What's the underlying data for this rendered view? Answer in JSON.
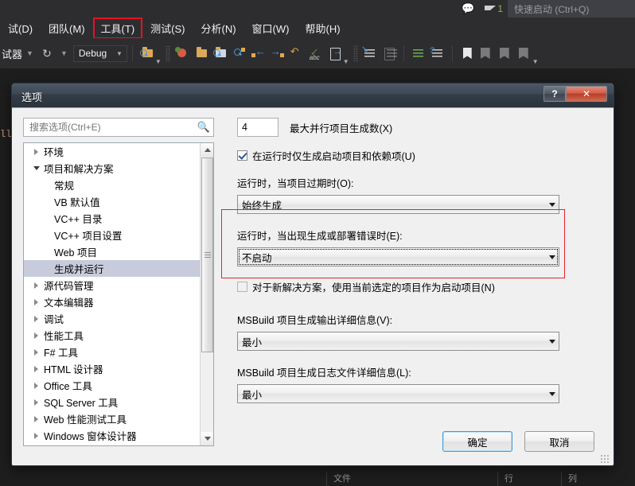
{
  "vs": {
    "title_icons": {
      "feedback": "feedback-icon",
      "notifications_count": "1"
    },
    "quick_launch_placeholder": "快速启动 (Ctrl+Q)",
    "menu": [
      {
        "label": "试(D)",
        "highlight": false
      },
      {
        "label": "团队(M)",
        "highlight": false
      },
      {
        "label": "工具(T)",
        "highlight": true
      },
      {
        "label": "测试(S)",
        "highlight": false
      },
      {
        "label": "分析(N)",
        "highlight": false
      },
      {
        "label": "窗口(W)",
        "highlight": false
      },
      {
        "label": "帮助(H)",
        "highlight": false
      }
    ],
    "toolbar": {
      "debugger_label": "试器",
      "config_value": "Debug"
    },
    "code_lines": [
      {
        "text": "ll;",
        "x": 0,
        "y": 76,
        "color": "#d69d85"
      }
    ],
    "statusbar": {
      "col1": "文件",
      "col2": "行",
      "col3": "列"
    },
    "accent_red": "#e8232a"
  },
  "dialog": {
    "title": "选项",
    "help_button": "?",
    "close_button": "✕",
    "search": {
      "placeholder": "搜索选项(Ctrl+E)",
      "value": ""
    },
    "tree": [
      {
        "label": "环境",
        "state": "collapsed",
        "level": 0,
        "selected": false
      },
      {
        "label": "项目和解决方案",
        "state": "expanded",
        "level": 0,
        "selected": false
      },
      {
        "label": "常规",
        "state": "leaf",
        "level": 1,
        "selected": false
      },
      {
        "label": "VB 默认值",
        "state": "leaf",
        "level": 1,
        "selected": false
      },
      {
        "label": "VC++ 目录",
        "state": "leaf",
        "level": 1,
        "selected": false
      },
      {
        "label": "VC++ 项目设置",
        "state": "leaf",
        "level": 1,
        "selected": false
      },
      {
        "label": "Web 项目",
        "state": "leaf",
        "level": 1,
        "selected": false
      },
      {
        "label": "生成并运行",
        "state": "leaf",
        "level": 1,
        "selected": true
      },
      {
        "label": "源代码管理",
        "state": "collapsed",
        "level": 0,
        "selected": false
      },
      {
        "label": "文本编辑器",
        "state": "collapsed",
        "level": 0,
        "selected": false
      },
      {
        "label": "调试",
        "state": "collapsed",
        "level": 0,
        "selected": false
      },
      {
        "label": "性能工具",
        "state": "collapsed",
        "level": 0,
        "selected": false
      },
      {
        "label": "F# 工具",
        "state": "collapsed",
        "level": 0,
        "selected": false
      },
      {
        "label": "HTML 设计器",
        "state": "collapsed",
        "level": 0,
        "selected": false
      },
      {
        "label": "Office 工具",
        "state": "collapsed",
        "level": 0,
        "selected": false
      },
      {
        "label": "SQL Server 工具",
        "state": "collapsed",
        "level": 0,
        "selected": false
      },
      {
        "label": "Web 性能测试工具",
        "state": "collapsed",
        "level": 0,
        "selected": false
      },
      {
        "label": "Windows 窗体设计器",
        "state": "collapsed",
        "level": 0,
        "selected": false
      }
    ],
    "options": {
      "max_parallel_builds_value": "4",
      "max_parallel_builds_label": "最大并行项目生成数(X)",
      "only_build_startup_label": "在运行时仅生成启动项目和依赖项(U)",
      "only_build_startup_checked": true,
      "on_run_outdated_label": "运行时，当项目过期时(O):",
      "on_run_outdated_value": "始终生成",
      "on_run_error_label": "运行时，当出现生成或部署错误时(E):",
      "on_run_error_value": "不启动",
      "new_solution_startup_label": "对于新解决方案，使用当前选定的项目作为启动项目(N)",
      "new_solution_startup_checked": false,
      "msbuild_output_label": "MSBuild 项目生成输出详细信息(V):",
      "msbuild_output_value": "最小",
      "msbuild_log_label": "MSBuild 项目生成日志文件详细信息(L):",
      "msbuild_log_value": "最小"
    },
    "footer": {
      "ok": "确定",
      "cancel": "取消"
    }
  }
}
